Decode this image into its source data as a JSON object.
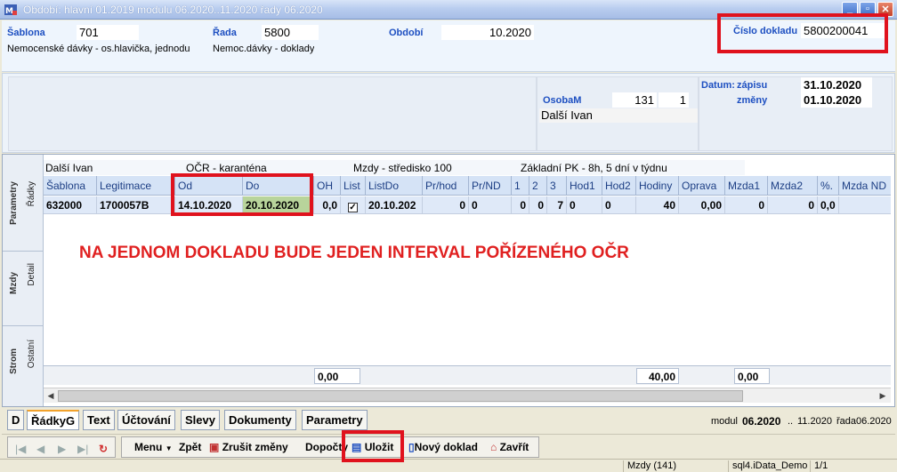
{
  "window": {
    "title": "Období: hlavní 01.2019 modulu 06.2020..11.2020 řady 06.2020"
  },
  "header": {
    "sablona_label": "Šablona",
    "sablona_value": "701",
    "sablona_desc": "Nemocenské dávky - os.hlavička, jednodu",
    "rada_label": "Řada",
    "rada_value": "5800",
    "rada_desc": "Nemoc.dávky - doklady",
    "obdobi_label": "Období",
    "obdobi_value": "10.2020",
    "cislo_label": "Číslo dokladu",
    "cislo_value": "5800200041"
  },
  "person": {
    "osoba_label": "OsobaM",
    "osoba_id": "131",
    "osoba_num": "1",
    "osoba_name": "Další Ivan",
    "datum_label": "Datum:",
    "zapisu_label": "zápisu",
    "zapisu_value": "31.10.2020",
    "zmeny_label": "změny",
    "zmeny_value": "01.10.2020"
  },
  "vtabs": {
    "parametry": "Parametry",
    "radky": "Řádky",
    "mzdy": "Mzdy",
    "detail": "Detail",
    "strom": "Strom",
    "ostatni": "Ostatní"
  },
  "infobar": {
    "name": "Další Ivan",
    "ocr": "OČR - karanténa",
    "mzdy": "Mzdy - středisko 100",
    "pk": "Základní PK - 8h, 5 dní v týdnu"
  },
  "grid": {
    "columns": [
      "Šablona",
      "Legitimace",
      "Od",
      "Do",
      "OH",
      "List",
      "ListDo",
      "Pr/hod",
      "Pr/ND",
      "1",
      "2",
      "3",
      "Hod1",
      "Hod2",
      "Hodiny",
      "Oprava",
      "Mzda1",
      "Mzda2",
      "%.",
      "Mzda ND"
    ],
    "row": {
      "sablona": "632000",
      "legitimace": "1700057B",
      "od": "14.10.2020",
      "do": "20.10.2020",
      "oh": "0,0",
      "list_checked": "✓",
      "listdo": "20.10.202",
      "prhod": "0",
      "prnd": "0",
      "c1": "0",
      "c2": "0",
      "c3": "7",
      "hod1": "0",
      "hod2": "0",
      "hodiny": "40",
      "oprava": "0,00",
      "mzda1": "0",
      "mzda2": "0",
      "pct": "0,0"
    },
    "sum_oh": "0,00",
    "sum_hodiny": "40,00",
    "sum_mzda": "0,00"
  },
  "notice": "NA JEDNOM DOKLADU BUDE JEDEN INTERVAL POŘÍZENÉHO OČR",
  "bottom_tabs": {
    "d": "D",
    "radkyg": "ŘádkyG",
    "text": "Text",
    "uctovani": "Účtování",
    "slevy": "Slevy",
    "dokumenty": "Dokumenty",
    "parametry": "Parametry"
  },
  "modul": {
    "label": "modul",
    "value": "06.2020",
    "sep": "..",
    "to": "11.2020",
    "rada_label": "řada",
    "rada_value": "06.2020"
  },
  "toolbar": {
    "menu": "Menu",
    "zpet": "Zpět",
    "zrusit": "Zrušit změny",
    "dopocty": "Dopočty",
    "ulozit": "Uložit",
    "novy": "Nový doklad",
    "zavrit": "Zavřít"
  },
  "statusbar": {
    "mzdy": "Mzdy (141)",
    "db": "sql4.iData_Demo",
    "pages": "1/1"
  }
}
